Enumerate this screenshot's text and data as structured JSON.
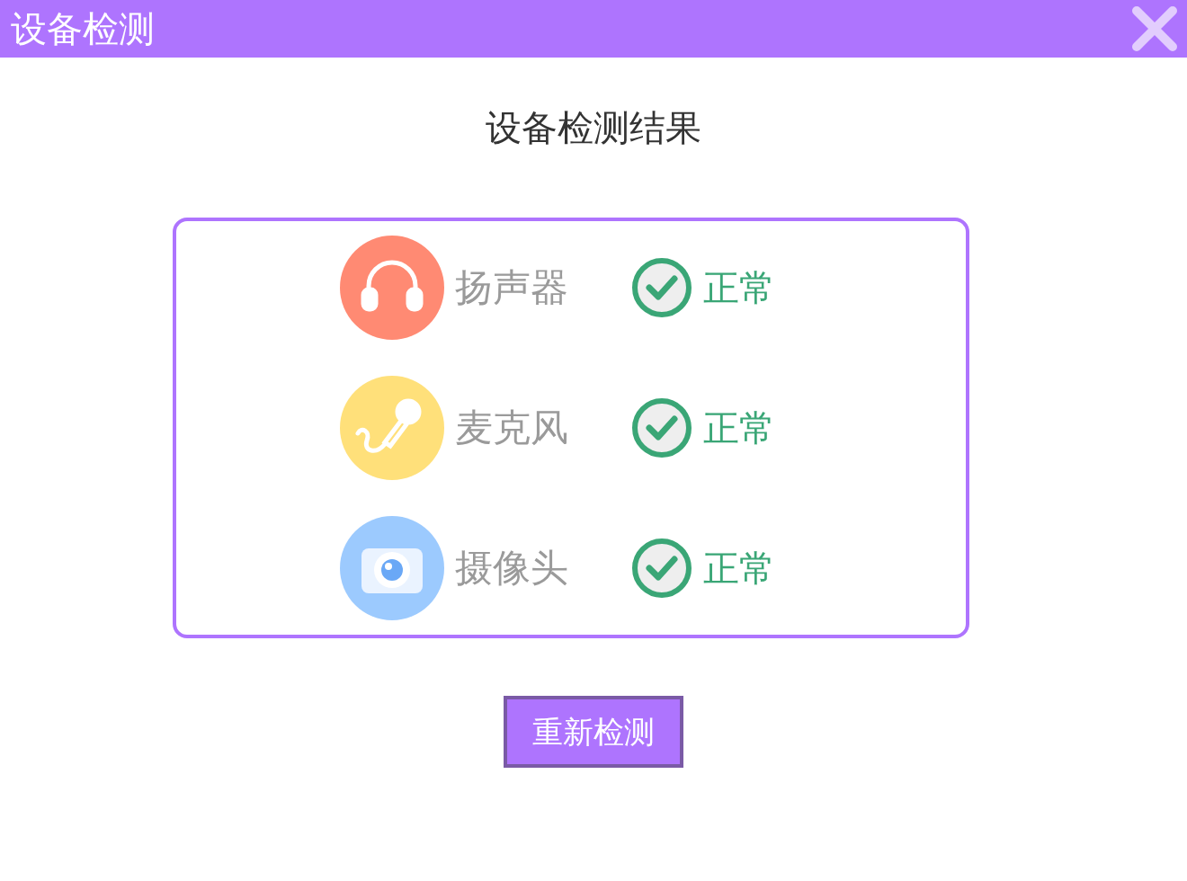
{
  "window": {
    "title": "设备检测"
  },
  "heading": "设备检测结果",
  "devices": [
    {
      "kind": "speaker",
      "name": "扬声器",
      "ok": true,
      "status": "正常"
    },
    {
      "kind": "microphone",
      "name": "麦克风",
      "ok": true,
      "status": "正常"
    },
    {
      "kind": "camera",
      "name": "摄像头",
      "ok": true,
      "status": "正常"
    }
  ],
  "button": "重新检测"
}
